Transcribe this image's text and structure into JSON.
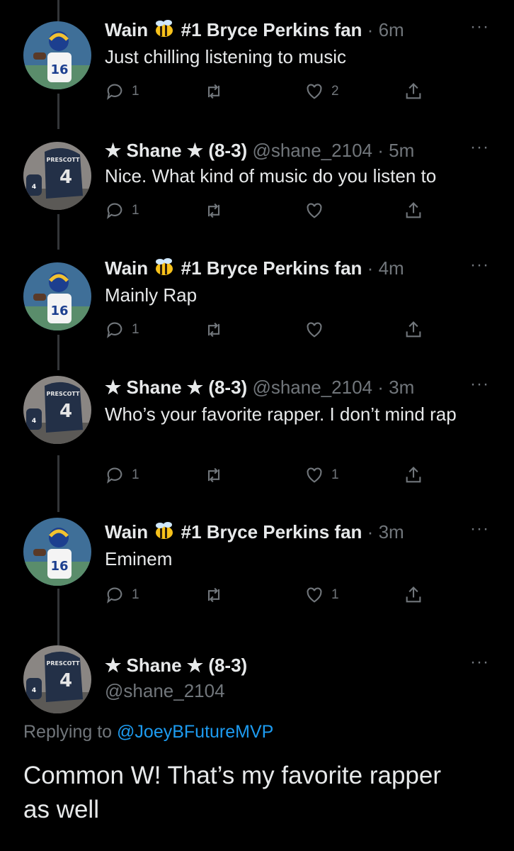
{
  "colors": {
    "background": "#000000",
    "text": "#e7e9ea",
    "muted": "#71767b",
    "link": "#1d9bf0",
    "thread_line": "#333639"
  },
  "tweets": [
    {
      "name": "Wain",
      "name_rest": "#1 Bryce Perkins fan",
      "handle": "",
      "time": "6m",
      "text": "Just chilling listening to music",
      "replies": "1",
      "retweets": "",
      "likes": "2"
    },
    {
      "name": "★ Shane ★ (8-3)",
      "name_rest": "",
      "handle": "@shane_2104",
      "time": "5m",
      "text": "Nice. What kind of music do you listen to",
      "replies": "1",
      "retweets": "",
      "likes": ""
    },
    {
      "name": "Wain",
      "name_rest": "#1 Bryce Perkins fan",
      "handle": "",
      "time": "4m",
      "text": "Mainly Rap",
      "replies": "1",
      "retweets": "",
      "likes": ""
    },
    {
      "name": "★ Shane ★ (8-3)",
      "name_rest": "",
      "handle": "@shane_2104",
      "time": "3m",
      "text": "Who’s your favorite rapper. I don’t mind rap",
      "replies": "1",
      "retweets": "",
      "likes": "1"
    },
    {
      "name": "Wain",
      "name_rest": "#1 Bryce Perkins fan",
      "handle": "",
      "time": "3m",
      "text": "Eminem",
      "replies": "1",
      "retweets": "",
      "likes": "1"
    }
  ],
  "main_tweet": {
    "name": "★ Shane ★ (8-3)",
    "handle": "@shane_2104",
    "replying_prefix": "Replying to",
    "replying_to": "@JoeyBFutureMVP",
    "text": "Common W! That’s my favorite rapper as well"
  },
  "icons": {
    "reply": "reply-icon",
    "retweet": "retweet-icon",
    "like": "heart-icon",
    "share": "share-icon",
    "more": "more-icon",
    "emoji": "bee-emoji-icon"
  },
  "more_glyph": "···",
  "separator": "·"
}
